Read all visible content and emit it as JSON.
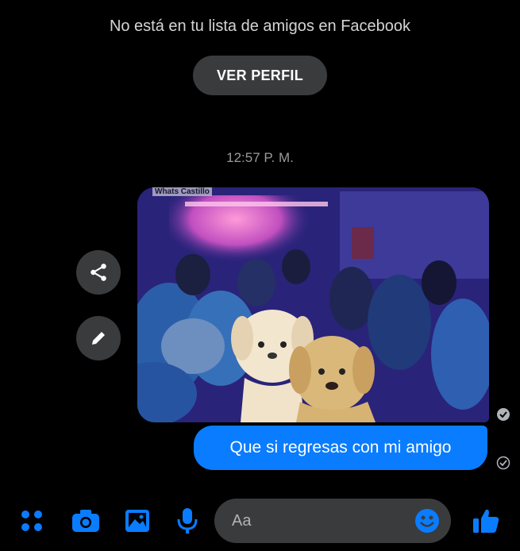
{
  "header": {
    "notice": "No está en tu lista de amigos en Facebook",
    "view_profile_label": "VER PERFIL"
  },
  "thread": {
    "timestamp": "12:57 P. M.",
    "image_watermark": "Whats Castillo",
    "message_text": "Que si regresas con mi amigo"
  },
  "composer": {
    "placeholder": "Aa"
  },
  "icons": {
    "side": [
      "share-icon",
      "pencil-icon"
    ],
    "bottom": [
      "menu-dots-icon",
      "camera-icon",
      "gallery-icon",
      "microphone-icon",
      "emoji-icon",
      "thumbs-up-icon"
    ]
  },
  "colors": {
    "accent": "#0a7cff",
    "background": "#000000",
    "button_bg": "#3a3b3c"
  }
}
